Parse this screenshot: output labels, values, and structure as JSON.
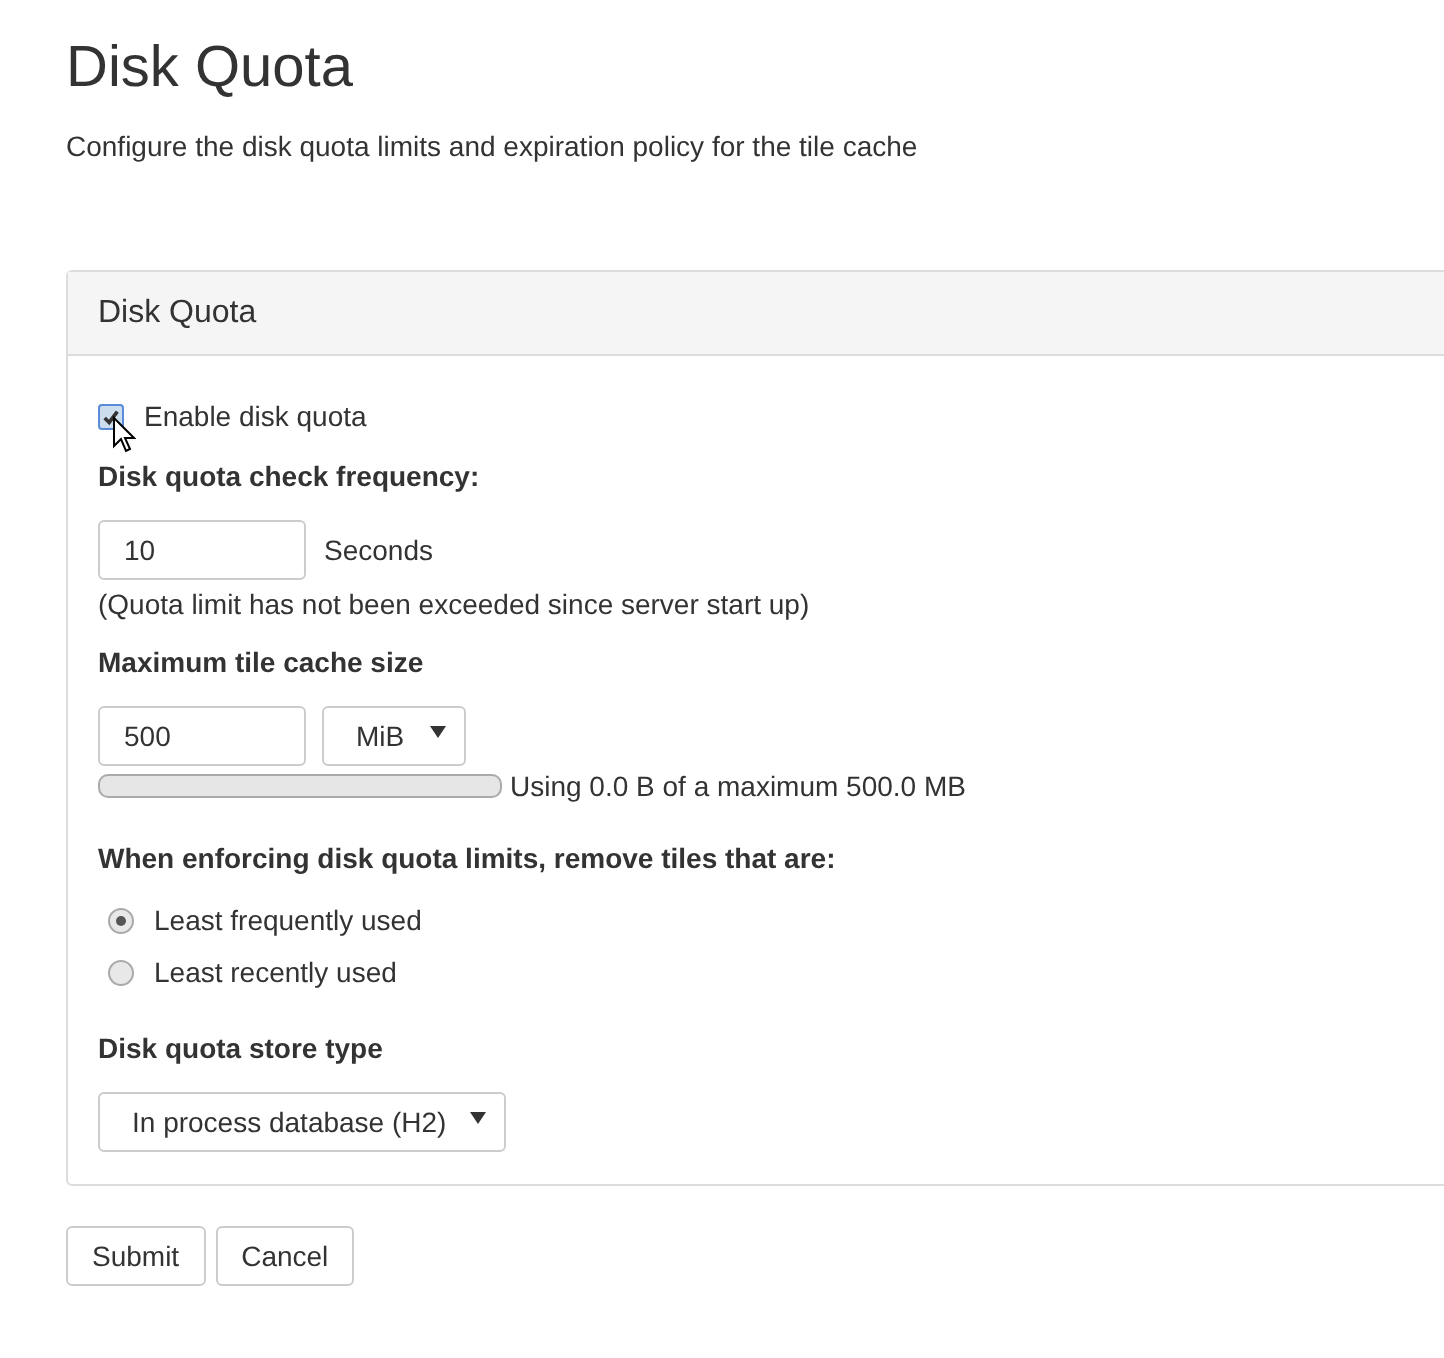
{
  "page": {
    "title": "Disk Quota",
    "subtitle": "Configure the disk quota limits and expiration policy for the tile cache"
  },
  "panel": {
    "title": "Disk Quota",
    "enable": {
      "label": "Enable disk quota",
      "checked": true
    },
    "frequency": {
      "label": "Disk quota check frequency:",
      "value": "10",
      "unit": "Seconds",
      "note": "(Quota limit has not been exceeded since server start up)"
    },
    "max_size": {
      "label": "Maximum tile cache size",
      "value": "500",
      "unit": "MiB",
      "level": 0,
      "usage": "Using 0.0 B of a maximum 500.0 MB"
    },
    "policy": {
      "label": "When enforcing disk quota limits, remove tiles that are:",
      "options": [
        {
          "label": "Least frequently used",
          "selected": true
        },
        {
          "label": "Least recently used",
          "selected": false
        }
      ]
    },
    "store": {
      "label": "Disk quota store type",
      "value": "In process database (H2)"
    }
  },
  "buttons": [
    "Submit",
    "Cancel"
  ]
}
